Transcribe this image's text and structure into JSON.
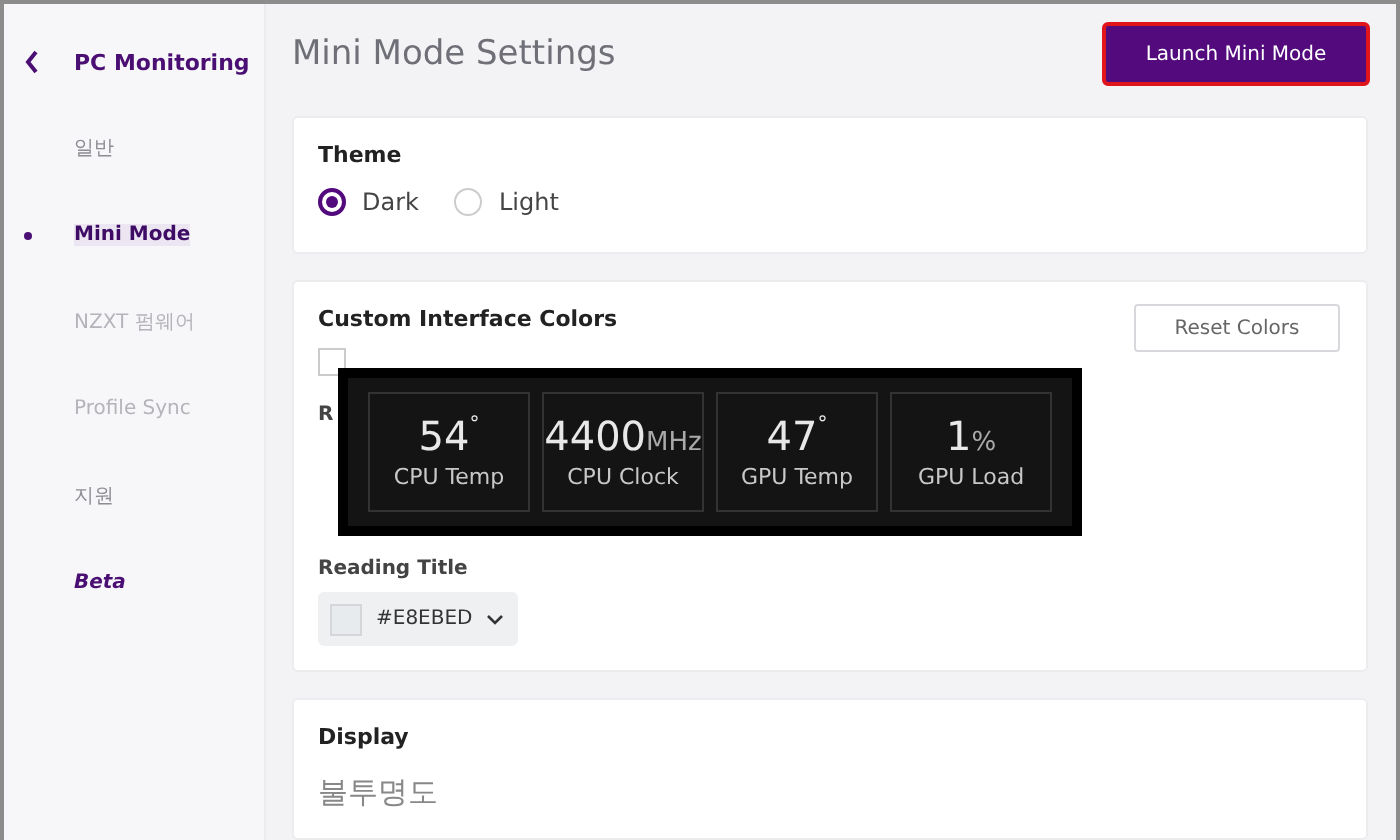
{
  "sidebar": {
    "back_label": "PC Monitoring",
    "items": [
      {
        "label": "일반",
        "kind": "item",
        "selected": false,
        "disabled": false
      },
      {
        "label": "Mini Mode",
        "kind": "item",
        "selected": true,
        "disabled": false
      },
      {
        "label": "NZXT 펌웨어",
        "kind": "item",
        "selected": false,
        "disabled": true
      },
      {
        "label": "Profile Sync",
        "kind": "item",
        "selected": false,
        "disabled": true
      },
      {
        "label": "지원",
        "kind": "item",
        "selected": false,
        "disabled": false
      },
      {
        "label": "Beta",
        "kind": "beta",
        "selected": false,
        "disabled": false
      }
    ]
  },
  "page_title": "Mini Mode Settings",
  "launch_button": "Launch Mini Mode",
  "theme": {
    "title": "Theme",
    "options": [
      {
        "label": "Dark",
        "selected": true
      },
      {
        "label": "Light",
        "selected": false
      }
    ]
  },
  "colors": {
    "title": "Custom Interface Colors",
    "reset_button": "Reset Colors",
    "enable": {
      "checked": false
    },
    "reading_label": "R",
    "reading_title_label": "Reading Title",
    "reading_title_value": "#E8EBED"
  },
  "mini_mode_preview": [
    {
      "value": "54",
      "unit": "°",
      "label": "CPU Temp",
      "kind": "degree"
    },
    {
      "value": "4400",
      "unit": "MHz",
      "label": "CPU Clock",
      "kind": "unit"
    },
    {
      "value": "47",
      "unit": "°",
      "label": "GPU Temp",
      "kind": "degree"
    },
    {
      "value": "1",
      "unit": "%",
      "label": "GPU Load",
      "kind": "unit"
    }
  ],
  "display": {
    "title": "Display",
    "opacity_label": "불투명도"
  }
}
